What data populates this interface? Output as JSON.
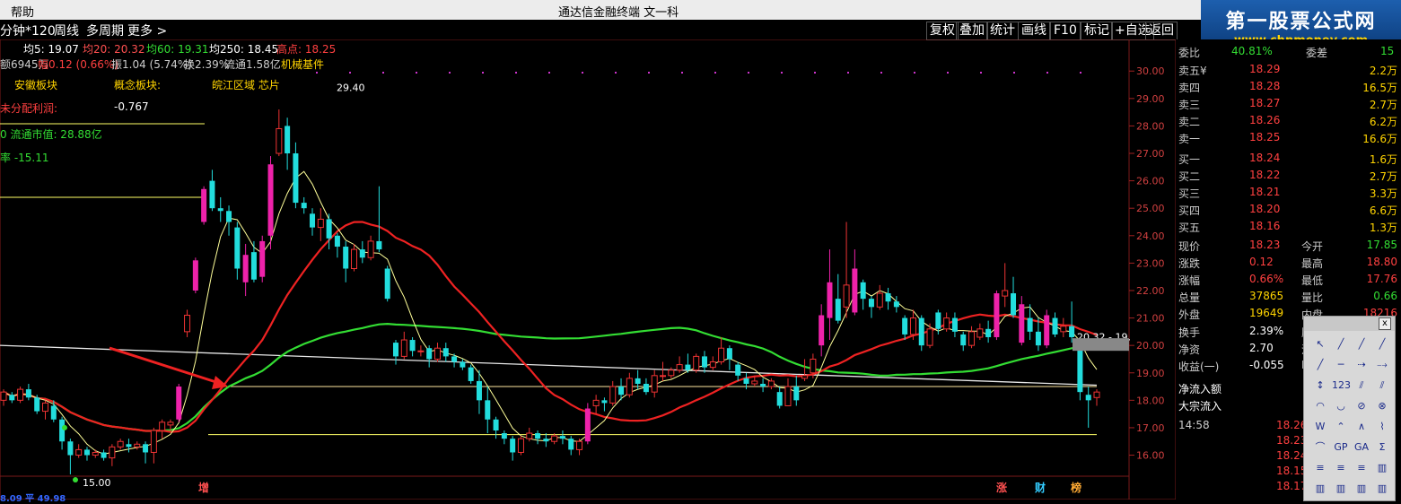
{
  "menubar": {
    "help": "帮助",
    "window_title": "通达信金融终端  文一科"
  },
  "logo": {
    "line1": "第一股票公式网",
    "line2": "www.chnmoney.com"
  },
  "toolbar": {
    "period": "分钟*120",
    "week": "周线",
    "multi": "多周期",
    "more": "更多 >"
  },
  "right_buttons": [
    "复权",
    "叠加",
    "统计",
    "画线",
    "F10",
    "标记",
    "+自选",
    "返回"
  ],
  "ma": {
    "ma5": "均5: 19.07",
    "ma20": "均20: 20.32",
    "ma60": "均60: 19.31",
    "ma250": "均250: 18.45",
    "high": "高点: 18.25"
  },
  "info": {
    "amount": "额6945万",
    "change": "幅0.12 (0.66%)",
    "amplitude": "振1.04 (5.74%)",
    "turnover": "换2.39%",
    "float": "流通1.58亿",
    "sector": "机械基件"
  },
  "overlay": {
    "region_sector": "安徽板块",
    "concept_label": "概念板块:",
    "concept_values": "皖江区域 芯片",
    "undistributed": "未分配利润:",
    "undistributed_val": "-0.767",
    "market_cap": "0  流通市值: 28.88亿",
    "rate": "率  -15.11"
  },
  "chart_data": {
    "type": "candlestick",
    "y_ticks": [
      "30.00",
      "29.00",
      "28.00",
      "27.00",
      "26.00",
      "25.00",
      "24.00",
      "23.00",
      "22.00",
      "21.00",
      "20.00",
      "19.00",
      "18.00",
      "17.00",
      "16.00"
    ],
    "ylim": [
      15.2,
      30.4
    ],
    "annotations": {
      "peak": "29.40",
      "trough": "15.00",
      "right_label": "20.32 - 19."
    },
    "bottom_markers": {
      "zeng": "增",
      "zhang": "涨",
      "cai": "财",
      "bang": "榜"
    },
    "bottom_axis": "8.09  平  49.98",
    "candles": [
      [
        18.0,
        18.3,
        17.8,
        18.4
      ],
      [
        18.2,
        18.0,
        17.9,
        18.3
      ],
      [
        18.0,
        18.4,
        17.9,
        18.5
      ],
      [
        18.4,
        18.1,
        18.0,
        18.6
      ],
      [
        18.1,
        17.6,
        17.5,
        18.2
      ],
      [
        17.6,
        17.9,
        17.3,
        18.0
      ],
      [
        17.8,
        17.3,
        17.2,
        18.0
      ],
      [
        17.3,
        16.5,
        16.2,
        17.4
      ],
      [
        16.5,
        16.0,
        15.3,
        16.6
      ],
      [
        16.0,
        16.2,
        15.9,
        16.4
      ],
      [
        16.2,
        16.0,
        15.8,
        16.3
      ],
      [
        16.0,
        16.1,
        15.9,
        16.2
      ],
      [
        16.1,
        15.9,
        15.8,
        16.2
      ],
      [
        15.9,
        16.3,
        15.6,
        16.4
      ],
      [
        16.3,
        16.5,
        16.2,
        16.6
      ],
      [
        16.4,
        16.3,
        16.1,
        16.6
      ],
      [
        16.3,
        16.4,
        16.2,
        16.5
      ],
      [
        16.4,
        16.1,
        15.7,
        16.5
      ],
      [
        16.1,
        16.9,
        15.7,
        17.0
      ],
      [
        16.9,
        17.2,
        16.6,
        17.3
      ],
      [
        17.1,
        17.2,
        16.9,
        17.3
      ],
      [
        17.3,
        18.5,
        17.2,
        18.6
      ],
      [
        20.5,
        21.1,
        20.3,
        21.3
      ],
      [
        22.0,
        23.1,
        21.9,
        23.2
      ],
      [
        24.5,
        25.7,
        24.4,
        25.8
      ],
      [
        26.0,
        25.0,
        24.9,
        26.4
      ],
      [
        25.0,
        24.9,
        24.5,
        25.4
      ],
      [
        24.9,
        24.5,
        24.0,
        25.1
      ],
      [
        24.3,
        22.8,
        22.4,
        24.5
      ],
      [
        22.3,
        23.3,
        21.8,
        23.7
      ],
      [
        23.4,
        22.4,
        22.3,
        23.8
      ],
      [
        22.5,
        23.8,
        22.3,
        24.0
      ],
      [
        24.0,
        26.6,
        23.5,
        26.9
      ],
      [
        27.0,
        27.9,
        26.9,
        28.6
      ],
      [
        28.0,
        27.0,
        26.4,
        28.3
      ],
      [
        27.0,
        25.2,
        25.0,
        27.4
      ],
      [
        25.2,
        25.0,
        24.8,
        25.4
      ],
      [
        24.8,
        24.3,
        24.0,
        25.0
      ],
      [
        24.3,
        24.6,
        23.8,
        25.0
      ],
      [
        24.6,
        23.9,
        23.5,
        24.8
      ],
      [
        24.0,
        23.6,
        23.2,
        24.1
      ],
      [
        23.6,
        22.8,
        22.3,
        23.8
      ],
      [
        22.8,
        23.5,
        22.7,
        23.7
      ],
      [
        23.5,
        23.2,
        23.0,
        23.8
      ],
      [
        23.2,
        23.8,
        23.1,
        24.0
      ],
      [
        23.8,
        23.5,
        23.4,
        25.8
      ],
      [
        22.8,
        21.7,
        21.6,
        22.9
      ],
      [
        20.1,
        19.6,
        19.3,
        20.2
      ],
      [
        19.6,
        20.2,
        19.5,
        20.5
      ],
      [
        20.2,
        19.8,
        19.6,
        20.3
      ],
      [
        19.8,
        19.8,
        19.6,
        20.0
      ],
      [
        19.9,
        19.5,
        19.2,
        20.0
      ],
      [
        19.5,
        19.9,
        19.4,
        20.1
      ],
      [
        19.9,
        19.6,
        19.4,
        20.1
      ],
      [
        19.6,
        19.4,
        19.2,
        19.7
      ],
      [
        19.4,
        19.2,
        19.1,
        19.5
      ],
      [
        19.2,
        18.7,
        18.6,
        19.3
      ],
      [
        18.7,
        18.0,
        17.5,
        19.1
      ],
      [
        18.0,
        17.3,
        16.8,
        18.5
      ],
      [
        17.3,
        16.9,
        16.6,
        17.4
      ],
      [
        16.8,
        16.6,
        16.4,
        16.9
      ],
      [
        16.6,
        16.1,
        15.8,
        16.7
      ],
      [
        16.1,
        16.6,
        16.0,
        16.7
      ],
      [
        16.6,
        16.8,
        16.5,
        17.0
      ],
      [
        16.8,
        16.6,
        16.4,
        16.9
      ],
      [
        16.6,
        16.5,
        16.3,
        16.8
      ],
      [
        16.5,
        16.7,
        16.4,
        16.8
      ],
      [
        16.7,
        16.6,
        16.4,
        16.9
      ],
      [
        16.6,
        16.2,
        16.0,
        16.7
      ],
      [
        16.2,
        16.5,
        16.0,
        16.6
      ],
      [
        16.5,
        17.7,
        16.4,
        17.9
      ],
      [
        17.8,
        18.0,
        17.5,
        18.2
      ],
      [
        18.0,
        17.9,
        17.6,
        18.1
      ],
      [
        17.9,
        18.5,
        17.8,
        18.7
      ],
      [
        18.5,
        18.2,
        18.0,
        18.8
      ],
      [
        18.2,
        18.8,
        18.1,
        19.0
      ],
      [
        18.8,
        18.6,
        18.4,
        19.1
      ],
      [
        18.6,
        18.3,
        18.2,
        18.8
      ],
      [
        18.3,
        18.9,
        18.1,
        19.1
      ],
      [
        18.9,
        18.9,
        18.7,
        19.4
      ],
      [
        18.9,
        19.1,
        18.8,
        19.2
      ],
      [
        19.1,
        19.3,
        19.0,
        19.6
      ],
      [
        19.3,
        19.1,
        19.0,
        19.7
      ],
      [
        19.1,
        19.6,
        19.0,
        19.7
      ],
      [
        19.6,
        19.2,
        19.0,
        19.8
      ],
      [
        19.2,
        19.4,
        19.1,
        19.6
      ],
      [
        19.4,
        19.9,
        19.3,
        20.3
      ],
      [
        19.9,
        19.5,
        19.1,
        20.0
      ],
      [
        19.3,
        18.9,
        18.7,
        19.4
      ],
      [
        18.8,
        18.6,
        18.4,
        19.0
      ],
      [
        18.6,
        18.7,
        18.5,
        18.9
      ],
      [
        18.6,
        18.5,
        18.3,
        18.8
      ],
      [
        18.5,
        18.7,
        18.4,
        18.8
      ],
      [
        18.3,
        17.8,
        17.7,
        18.5
      ],
      [
        17.8,
        18.5,
        17.8,
        18.8
      ],
      [
        18.5,
        18.0,
        17.8,
        18.9
      ],
      [
        18.8,
        18.9,
        18.7,
        19.5
      ],
      [
        19.0,
        19.5,
        18.8,
        19.7
      ],
      [
        20.0,
        21.1,
        19.6,
        21.5
      ],
      [
        21.0,
        22.3,
        20.2,
        23.5
      ],
      [
        21.7,
        20.9,
        20.8,
        22.6
      ],
      [
        21.4,
        22.2,
        21.0,
        24.5
      ],
      [
        21.2,
        22.8,
        21.1,
        23.5
      ],
      [
        22.3,
        21.7,
        21.3,
        22.4
      ],
      [
        21.7,
        21.4,
        21.0,
        21.8
      ],
      [
        21.4,
        21.9,
        21.3,
        22.2
      ],
      [
        21.9,
        21.6,
        21.3,
        22.1
      ],
      [
        21.6,
        21.4,
        21.2,
        21.8
      ],
      [
        21.0,
        20.4,
        20.2,
        21.1
      ],
      [
        20.4,
        21.0,
        20.2,
        21.3
      ],
      [
        21.0,
        20.0,
        19.8,
        21.1
      ],
      [
        20.0,
        20.6,
        19.9,
        20.8
      ],
      [
        21.2,
        20.6,
        20.4,
        21.3
      ],
      [
        20.6,
        21.0,
        20.5,
        21.2
      ],
      [
        21.0,
        20.5,
        20.3,
        21.2
      ],
      [
        20.4,
        20.0,
        19.8,
        20.5
      ],
      [
        20.0,
        20.5,
        19.9,
        20.7
      ],
      [
        20.3,
        20.6,
        20.2,
        20.8
      ],
      [
        20.6,
        20.3,
        20.1,
        20.9
      ],
      [
        20.3,
        21.9,
        20.2,
        22.0
      ],
      [
        21.8,
        22.0,
        21.4,
        23.0
      ],
      [
        21.9,
        21.1,
        21.0,
        22.5
      ],
      [
        20.1,
        21.5,
        20.0,
        21.8
      ],
      [
        21.0,
        20.5,
        20.2,
        21.5
      ],
      [
        20.5,
        20.0,
        19.8,
        21.0
      ],
      [
        20.0,
        21.1,
        19.9,
        21.3
      ],
      [
        21.0,
        20.4,
        20.3,
        21.2
      ],
      [
        20.5,
        20.7,
        20.3,
        21.0
      ],
      [
        20.7,
        20.3,
        20.1,
        21.6
      ],
      [
        20.0,
        18.3,
        18.0,
        20.2
      ],
      [
        18.2,
        18.0,
        17.0,
        18.5
      ],
      [
        18.1,
        18.3,
        17.8,
        18.4
      ]
    ]
  },
  "panel": {
    "ratio_label": "委比",
    "ratio_val": "40.81%",
    "diff_label": "委差",
    "diff_val": "15",
    "asks": [
      {
        "label": "卖五¥",
        "price": "18.29",
        "vol": "2.2万"
      },
      {
        "label": "卖四",
        "price": "18.28",
        "vol": "16.5万"
      },
      {
        "label": "卖三",
        "price": "18.27",
        "vol": "2.7万"
      },
      {
        "label": "卖二",
        "price": "18.26",
        "vol": "6.2万"
      },
      {
        "label": "卖一",
        "price": "18.25",
        "vol": "16.6万"
      }
    ],
    "bids": [
      {
        "label": "买一",
        "price": "18.24",
        "vol": "1.6万"
      },
      {
        "label": "买二",
        "price": "18.22",
        "vol": "2.7万"
      },
      {
        "label": "买三",
        "price": "18.21",
        "vol": "3.3万"
      },
      {
        "label": "买四",
        "price": "18.20",
        "vol": "6.6万"
      },
      {
        "label": "买五",
        "price": "18.16",
        "vol": "1.3万"
      }
    ],
    "stats": [
      {
        "l1": "现价",
        "v1": "18.23",
        "l2": "今开",
        "v2": "17.85"
      },
      {
        "l1": "涨跌",
        "v1": "0.12",
        "l2": "最高",
        "v2": "18.80"
      },
      {
        "l1": "涨幅",
        "v1": "0.66%",
        "l2": "最低",
        "v2": "17.76"
      },
      {
        "l1": "总量",
        "v1": "37865",
        "l2": "量比",
        "v2": "0.66"
      },
      {
        "l1": "外盘",
        "v1": "19649",
        "l2": "内盘",
        "v2": "18216"
      }
    ],
    "stats2": [
      {
        "l1": "换手",
        "v1": "2.39%",
        "l2": "股"
      },
      {
        "l1": "净资",
        "v1": "2.70",
        "l2": "流"
      },
      {
        "l1": "收益(一)",
        "v1": "-0.055",
        "l2": "PE"
      }
    ],
    "flow1": "净流入额",
    "flow2": "大宗流入",
    "ticks": [
      {
        "t": "14:58",
        "p": "18.26"
      },
      {
        "t": "",
        "p": "18.23"
      },
      {
        "t": "",
        "p": "18.24"
      },
      {
        "t": "",
        "p": "18.15"
      },
      {
        "t": "",
        "p": "18.17"
      }
    ]
  },
  "palette": {
    "close": "x",
    "glyphs": [
      "↖",
      "╱",
      "╱",
      "╱",
      "╱",
      "─",
      "⇢",
      "⤍",
      "↕",
      "123",
      "⫽",
      "⫽",
      "◠",
      "◡",
      "⊘",
      "⊗",
      "W",
      "⌃",
      "∧",
      "⌇",
      "⌒",
      "GP",
      "GA",
      "Σ",
      "≡",
      "≡",
      "≡",
      "▥",
      "▥",
      "▥",
      "▥",
      "▥"
    ]
  }
}
